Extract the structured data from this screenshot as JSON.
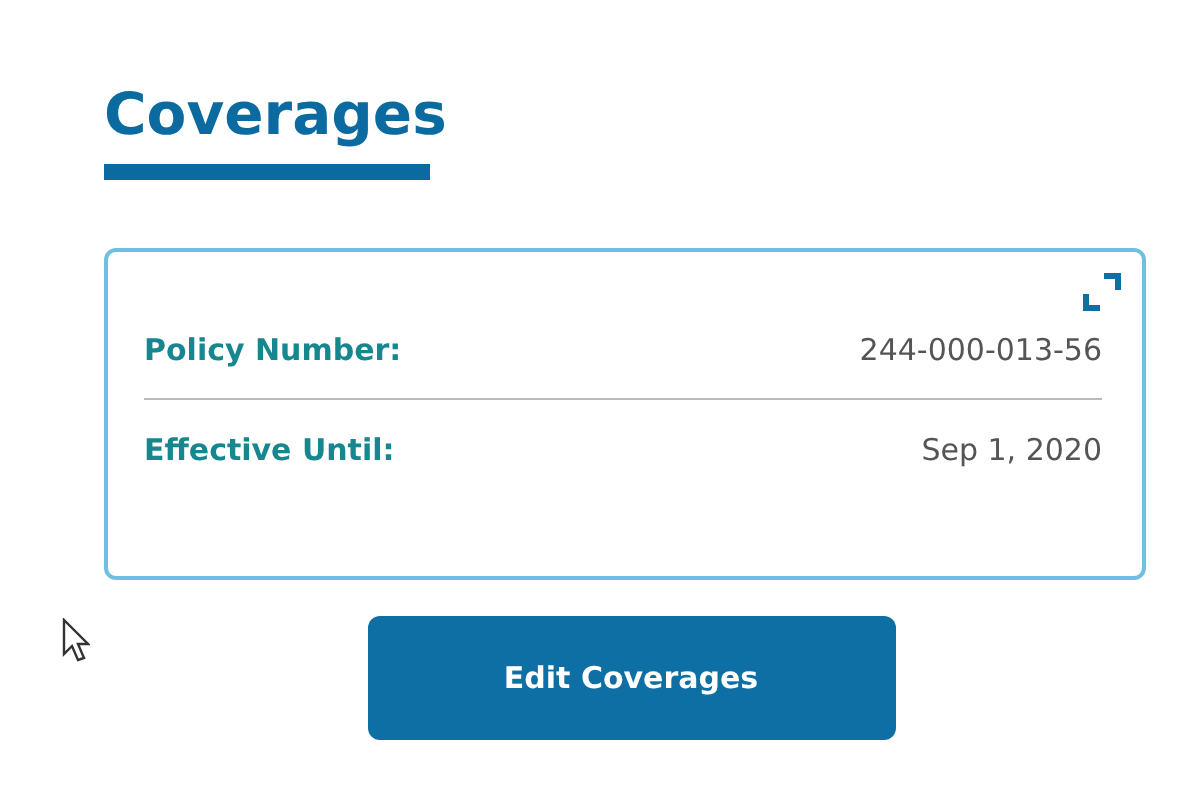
{
  "title": "Coverages",
  "card": {
    "rows": [
      {
        "label": "Policy Number:",
        "value": "244-000-013-56"
      },
      {
        "label": "Effective Until:",
        "value": "Sep 1, 2020"
      }
    ]
  },
  "button": "Edit Coverages"
}
